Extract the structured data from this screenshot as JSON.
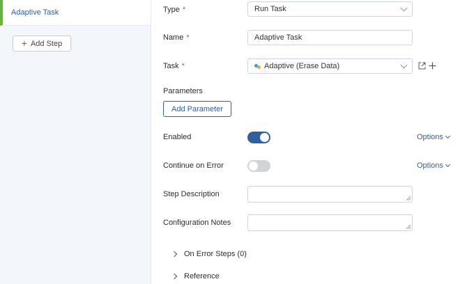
{
  "sidebar": {
    "steps": [
      {
        "label": "Adaptive Task"
      }
    ],
    "add_step_label": "Add Step"
  },
  "form": {
    "type": {
      "label": "Type",
      "value": "Run Task"
    },
    "name": {
      "label": "Name",
      "value": "Adaptive Task"
    },
    "task": {
      "label": "Task",
      "value": "Adaptive (Erase Data)"
    },
    "parameters": {
      "label": "Parameters",
      "add_button": "Add Parameter"
    },
    "enabled": {
      "label": "Enabled",
      "state": true,
      "options_label": "Options"
    },
    "continue_on_error": {
      "label": "Continue on Error",
      "state": false,
      "options_label": "Options"
    },
    "step_description": {
      "label": "Step Description",
      "value": ""
    },
    "configuration_notes": {
      "label": "Configuration Notes",
      "value": ""
    },
    "on_error_steps": {
      "label": "On Error Steps (0)"
    },
    "reference": {
      "label": "Reference"
    }
  },
  "colors": {
    "accent": "#2f5f9e",
    "required": "#d94a4a",
    "active_step_bar": "#6ab23f",
    "sidebar_bg": "#f3f6fb",
    "toggle_off": "#d0d3d8"
  },
  "icons": {
    "required_marker": "*",
    "task_logo": "adaptive-logo-icon",
    "open_external": "external-link-icon",
    "add": "plus-icon"
  }
}
